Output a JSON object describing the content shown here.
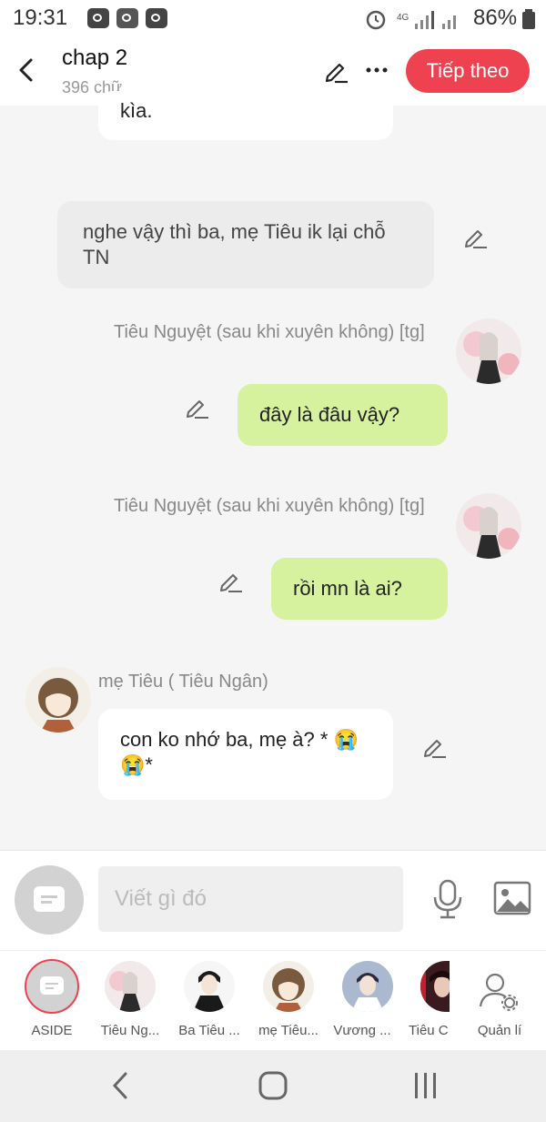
{
  "status": {
    "time": "19:31",
    "battery": "86%"
  },
  "header": {
    "title": "chap 2",
    "word_count": "396 chữ",
    "next_label": "Tiếp theo"
  },
  "messages": {
    "m0_text": "kìa.",
    "m1_text": "nghe vậy thì ba, mẹ Tiêu ik lại chỗ TN",
    "m2_name": "Tiêu Nguyệt (sau khi xuyên không) [tg]",
    "m2_text": "đây là đâu vậy?",
    "m3_name": "Tiêu Nguyệt (sau khi xuyên không) [tg]",
    "m3_text": "rồi mn là ai?",
    "m4_name": "mẹ Tiêu ( Tiêu Ngân)",
    "m4_text": "con ko nhớ ba, mẹ à? * 😭😭*"
  },
  "composer": {
    "placeholder": "Viết gì đó"
  },
  "characters": [
    {
      "label": "ASIDE"
    },
    {
      "label": "Tiêu Ng..."
    },
    {
      "label": "Ba Tiêu ..."
    },
    {
      "label": "mẹ Tiêu..."
    },
    {
      "label": "Vương ..."
    },
    {
      "label": "Tiêu C"
    },
    {
      "label": "Quản lí"
    }
  ],
  "colors": {
    "accent": "#ee4250",
    "bubble_green": "#d6f29f"
  }
}
